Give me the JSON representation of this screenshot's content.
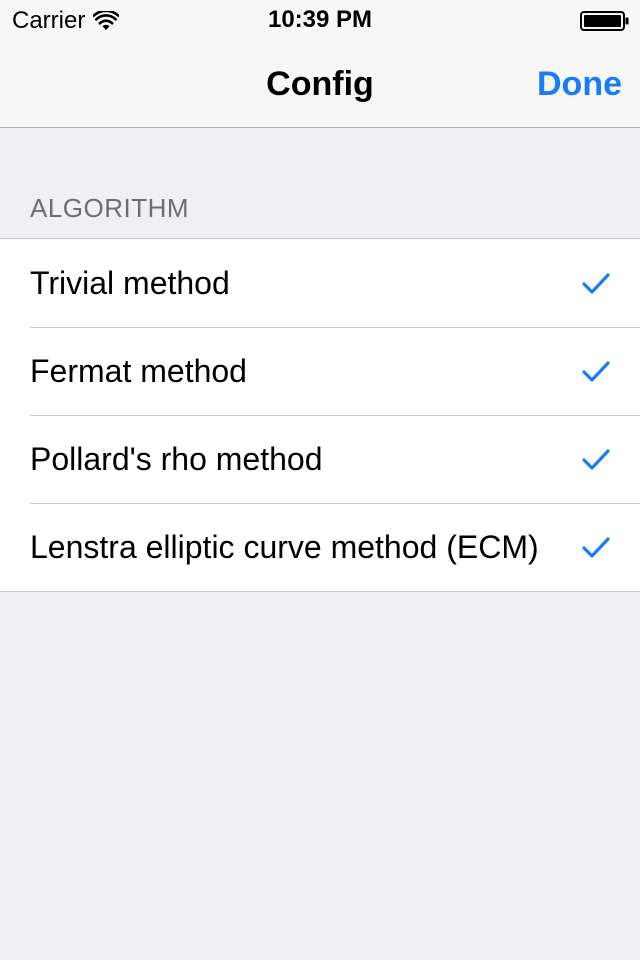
{
  "status_bar": {
    "carrier": "Carrier",
    "time": "10:39 PM",
    "wifi_icon": "wifi-icon",
    "battery_icon": "battery-icon"
  },
  "nav": {
    "title": "Config",
    "done_label": "Done",
    "accent_color": "#1a7cf5"
  },
  "section": {
    "header": "ALGORITHM",
    "items": [
      {
        "label": "Trivial method",
        "checked": true,
        "icon": "checkmark-icon"
      },
      {
        "label": "Fermat method",
        "checked": true,
        "icon": "checkmark-icon"
      },
      {
        "label": "Pollard's rho method",
        "checked": true,
        "icon": "checkmark-icon"
      },
      {
        "label": "Lenstra elliptic curve method (ECM)",
        "checked": true,
        "icon": "checkmark-icon"
      }
    ]
  },
  "colors": {
    "background": "#efeff4",
    "bar_background": "#f7f7f7",
    "section_header_text": "#6d6d72",
    "separator": "#c8c7cc"
  }
}
